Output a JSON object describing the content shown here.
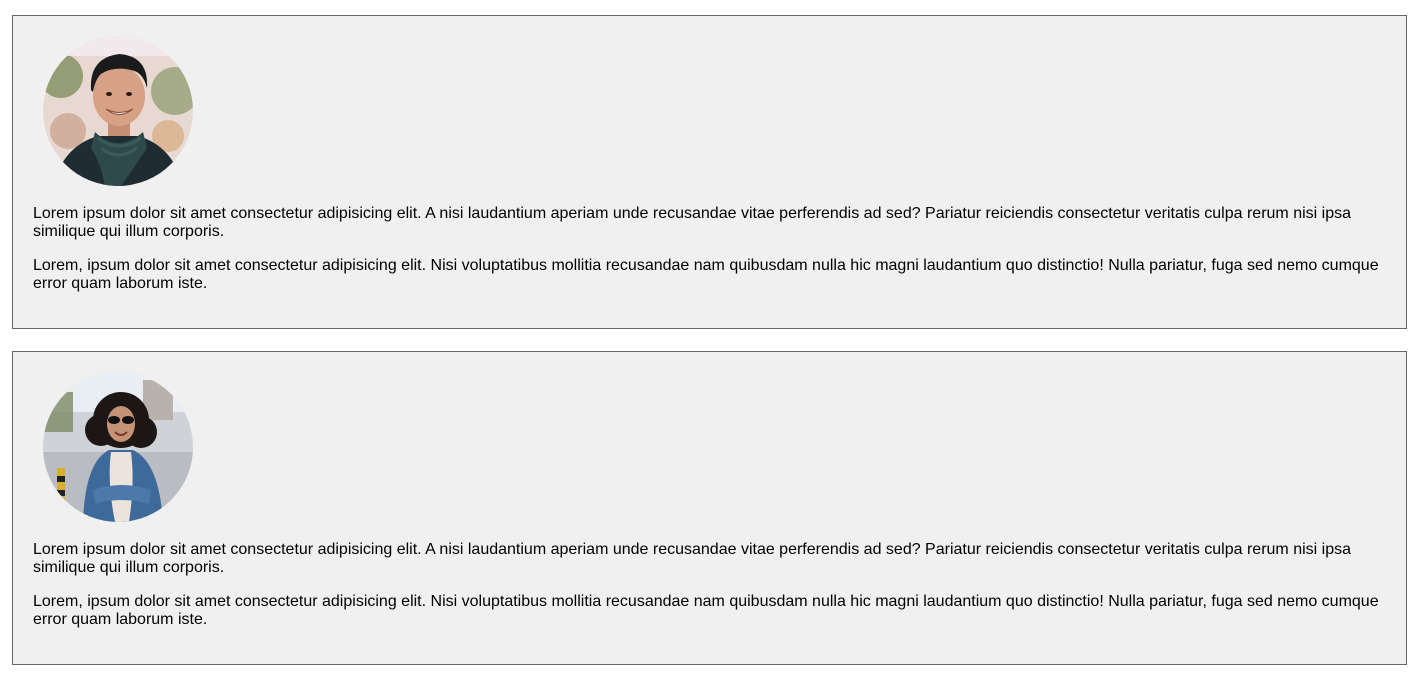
{
  "cards": [
    {
      "avatar_icon": "smiling-man-with-scarf-photo",
      "paragraphs": [
        "Lorem ipsum dolor sit amet consectetur adipisicing elit. A nisi laudantium aperiam unde recusandae vitae perferendis ad sed? Pariatur reiciendis consectetur veritatis culpa rerum nisi ipsa similique qui illum corporis.",
        "Lorem, ipsum dolor sit amet consectetur adipisicing elit. Nisi voluptatibus mollitia recusandae nam quibusdam nulla hic magni laudantium quo distinctio! Nulla pariatur, fuga sed nemo cumque error quam laborum iste."
      ]
    },
    {
      "avatar_icon": "woman-curly-hair-sunglasses-photo",
      "paragraphs": [
        "Lorem ipsum dolor sit amet consectetur adipisicing elit. A nisi laudantium aperiam unde recusandae vitae perferendis ad sed? Pariatur reiciendis consectetur veritatis culpa rerum nisi ipsa similique qui illum corporis.",
        "Lorem, ipsum dolor sit amet consectetur adipisicing elit. Nisi voluptatibus mollitia recusandae nam quibusdam nulla hic magni laudantium quo distinctio! Nulla pariatur, fuga sed nemo cumque error quam laborum iste."
      ]
    }
  ],
  "colors": {
    "card_background": "#f0f0f0",
    "card_border": "#666666",
    "text": "#000000"
  }
}
